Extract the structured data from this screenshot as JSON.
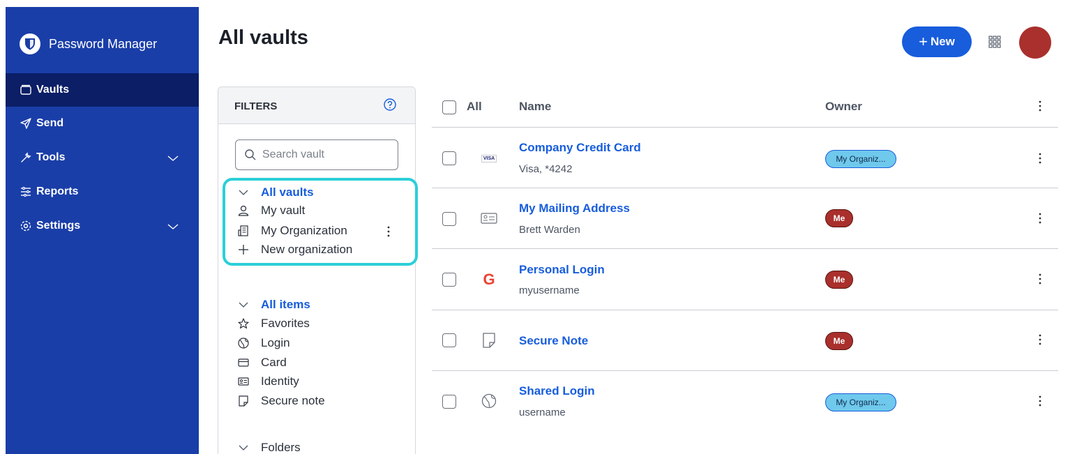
{
  "app": {
    "brand_name": "Password Manager"
  },
  "colors": {
    "sidebar": "#1a3ea8",
    "sidebar_active": "#0b1e66",
    "accent": "#175ddc",
    "highlight": "#2bcfd8",
    "avatar": "#a9302c"
  },
  "nav": [
    {
      "label": "Vaults",
      "icon": "vault-icon",
      "active": true
    },
    {
      "label": "Send",
      "icon": "send-icon"
    },
    {
      "label": "Tools",
      "icon": "tools-icon",
      "expandable": true
    },
    {
      "label": "Reports",
      "icon": "reports-icon"
    },
    {
      "label": "Settings",
      "icon": "gear-icon",
      "expandable": true
    }
  ],
  "header": {
    "title": "All vaults",
    "new_label": "New"
  },
  "filters": {
    "title": "FILTERS",
    "search_placeholder": "Search vault",
    "vaults_heading": "All vaults",
    "vaults": [
      "My vault",
      "My Organization",
      "New organization"
    ],
    "items_heading": "All items",
    "types": [
      "Favorites",
      "Login",
      "Card",
      "Identity",
      "Secure note"
    ],
    "folders_heading": "Folders"
  },
  "table": {
    "col_all": "All",
    "col_name": "Name",
    "col_owner": "Owner",
    "rows": [
      {
        "name": "Company Credit Card",
        "sub": "Visa, *4242",
        "icon": "visa-card-icon",
        "icon_text": "VISA",
        "owner": "My Organiz..."
      },
      {
        "name": "My Mailing Address",
        "sub": "Brett Warden",
        "icon": "identity-icon",
        "owner": "Me"
      },
      {
        "name": "Personal Login",
        "sub": "myusername",
        "icon": "google-icon",
        "icon_text": "G",
        "owner": "Me"
      },
      {
        "name": "Secure Note",
        "sub": "",
        "icon": "note-icon",
        "owner": "Me"
      },
      {
        "name": "Shared Login",
        "sub": "username",
        "icon": "globe-icon",
        "owner": "My Organiz..."
      }
    ]
  }
}
